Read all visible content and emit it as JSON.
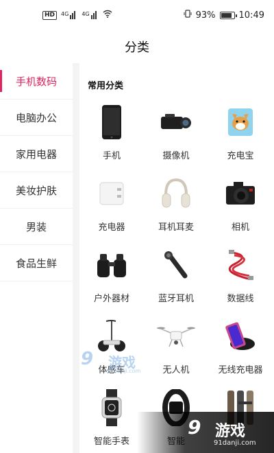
{
  "status_bar": {
    "hd": "HD",
    "signal_tag_1": "4G",
    "signal_tag_2": "4G",
    "battery_percent": 93,
    "battery_text": "93%",
    "time": "10:49"
  },
  "header": {
    "title": "分类"
  },
  "sidebar": {
    "items": [
      {
        "label": "手机数码",
        "active": true
      },
      {
        "label": "电脑办公",
        "active": false
      },
      {
        "label": "家用电器",
        "active": false
      },
      {
        "label": "美妆护肤",
        "active": false
      },
      {
        "label": "男装",
        "active": false
      },
      {
        "label": "食品生鲜",
        "active": false
      }
    ]
  },
  "main": {
    "section_title": "常用分类",
    "items": [
      {
        "label": "手机",
        "icon": "smartphone-icon"
      },
      {
        "label": "摄像机",
        "icon": "camcorder-icon"
      },
      {
        "label": "充电宝",
        "icon": "power-bank-icon"
      },
      {
        "label": "充电器",
        "icon": "charger-icon"
      },
      {
        "label": "耳机耳麦",
        "icon": "headphones-icon"
      },
      {
        "label": "相机",
        "icon": "camera-icon"
      },
      {
        "label": "户外器材",
        "icon": "binoculars-icon"
      },
      {
        "label": "蓝牙耳机",
        "icon": "bluetooth-earpiece-icon"
      },
      {
        "label": "数据线",
        "icon": "data-cable-icon"
      },
      {
        "label": "体感车",
        "icon": "balance-scooter-icon"
      },
      {
        "label": "无人机",
        "icon": "drone-icon"
      },
      {
        "label": "无线充电器",
        "icon": "wireless-charger-icon"
      },
      {
        "label": "智能手表",
        "icon": "smartwatch-icon"
      },
      {
        "label": "智能",
        "icon": "smart-band-icon"
      },
      {
        "label": "",
        "icon": "smart-lock-icon"
      }
    ]
  },
  "watermark": {
    "mid_logo": "9",
    "mid_text": "游戏",
    "mid_url": "91danji.com",
    "corner_logo": "9",
    "corner_text": "游戏",
    "corner_url": "91danji.com"
  },
  "colors": {
    "accent": "#e0245e",
    "divider": "#f4f4f4"
  }
}
